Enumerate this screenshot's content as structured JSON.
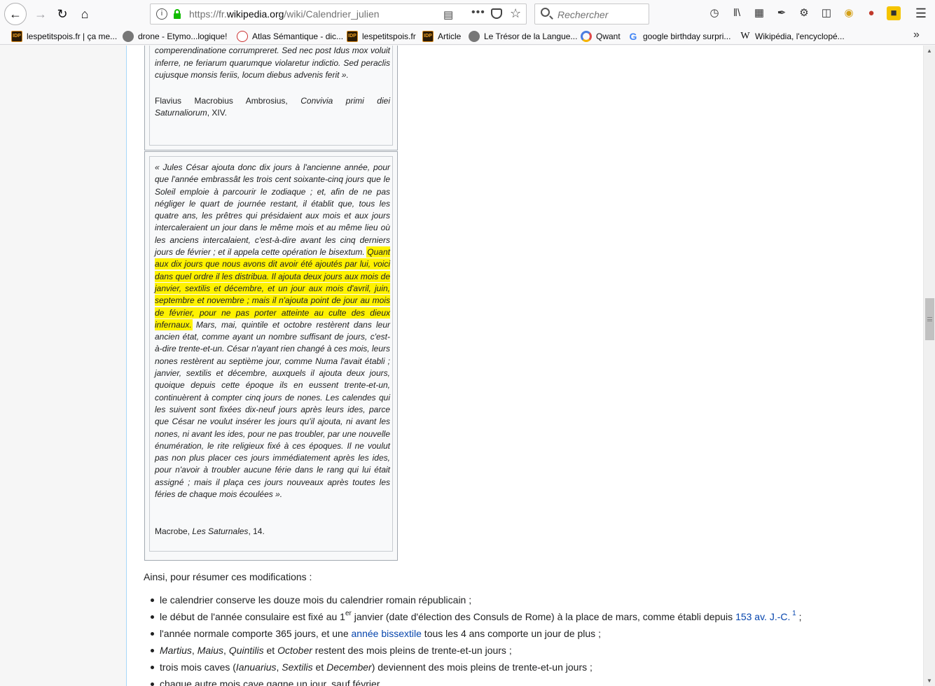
{
  "browser": {
    "url_prefix": "https://fr.",
    "url_domain": "wikipedia.org",
    "url_path": "/wiki/Calendrier_julien",
    "search_placeholder": "Rechercher",
    "url_more": "•••"
  },
  "bookmarks": [
    {
      "label": "lespetitspois.fr | ça me...",
      "icon": "lespetitspois-icon"
    },
    {
      "label": "drone - Etymo...logique!",
      "icon": "globe-icon"
    },
    {
      "label": "Atlas Sémantique - dic...",
      "icon": "atlas-icon"
    },
    {
      "label": "lespetitspois.fr",
      "icon": "lespetitspois-icon"
    },
    {
      "label": "Article",
      "icon": "lespetitspois-icon"
    },
    {
      "label": "Le Trésor de la Langue...",
      "icon": "globe-icon"
    },
    {
      "label": "Qwant",
      "icon": "qwant-icon"
    },
    {
      "label": "google birthday surpri...",
      "icon": "google-icon"
    },
    {
      "label": "Wikipédia, l'encyclopé...",
      "icon": "wikipedia-icon"
    }
  ],
  "quote1": {
    "text": "Iduum religionem, quae stato erant die, novella comperendinatione corrumpreret. Sed nec post Idus mox voluit inferre, ne feriarum quarumque violaretur indictio. Sed peraclis cujusque monsis feriis, locum diebus advenis ferit ».",
    "attrib_author": "Flavius Macrobius Ambrosius,",
    "attrib_work": "Convivia primi diei Saturnaliorum",
    "attrib_ref": ", XIV."
  },
  "quote2": {
    "text_before": "« Jules César ajouta donc dix jours à l'ancienne année, pour que l'année embrassât les trois cent soixante-cinq jours que le Soleil emploie à parcourir le zodiaque ; et, afin de ne pas négliger le quart de journée restant, il établit que, tous les quatre ans, les prêtres qui présidaient aux mois et aux jours intercaleraient un jour dans le même mois et au même lieu où les anciens intercalaient, c'est-à-dire avant les cinq derniers jours de février ; et il appela cette opération le bisextum.",
    "text_highlight": "Quant aux dix jours que nous avons dit avoir été ajoutés par lui, voici dans quel ordre il les distribua. Il ajouta deux jours aux mois de janvier, sextilis et décembre, et un jour aux mois d'avril, juin, septembre et novembre ; mais il n'ajouta point de jour au mois de février, pour ne pas porter atteinte au culte des dieux infernaux.",
    "text_after": "Mars, mai, quintile et octobre restèrent dans leur ancien état, comme ayant un nombre suffisant de jours, c'est-à-dire trente-et-un. César n'ayant rien changé à ces mois, leurs nones restèrent au septième jour, comme Numa l'avait établi ; janvier, sextilis et décembre, auxquels il ajouta deux jours, quoique depuis cette époque ils en eussent trente-et-un, continuèrent à compter cinq jours de nones. Les calendes qui les suivent sont fixées dix-neuf jours après leurs ides, parce que César ne voulut insérer les jours qu'il ajouta, ni avant les nones, ni avant les ides, pour ne pas troubler, par une nouvelle énumération, le rite religieux fixé à ces époques. Il ne voulut pas non plus placer ces jours immédiatement après les ides, pour n'avoir à troubler aucune férie dans le rang qui lui était assigné ; mais il plaça ces jours nouveaux après toutes les féries de chaque mois écoulées ».",
    "attrib_author": "Macrobe,",
    "attrib_work": "Les Saturnales",
    "attrib_ref": ", 14."
  },
  "intro": "Ainsi, pour résumer ces modifications :",
  "items": {
    "i1": "le calendrier conserve les douze mois du calendrier romain républicain ;",
    "i2a": "le début de l'année consulaire est fixé au 1",
    "i2sup": "er",
    "i2b": " janvier (date d'élection des Consuls de Rome) à la place de mars, comme établi depuis ",
    "i2link": "153 av. J.-C.",
    "i2note": "1",
    "i2c": " ;",
    "i3a": "l'année normale comporte 365 jours, et une ",
    "i3link": "année bissextile",
    "i3b": " tous les 4 ans comporte un jour de plus ;",
    "i4a": "Martius",
    "i4b": ", ",
    "i4c": "Maius",
    "i4d": ", ",
    "i4e": "Quintilis",
    "i4f": " et ",
    "i4g": "October",
    "i4h": " restent des mois pleins de trente-et-un jours ;",
    "i5a": "trois mois caves (",
    "i5b": "Ianuarius",
    "i5c": ", ",
    "i5d": "Sextilis",
    "i5e": " et ",
    "i5f": "December",
    "i5g": ") deviennent des mois pleins de trente-et-un jours ;",
    "i6": "chaque autre mois cave gagne un jour, sauf février"
  }
}
